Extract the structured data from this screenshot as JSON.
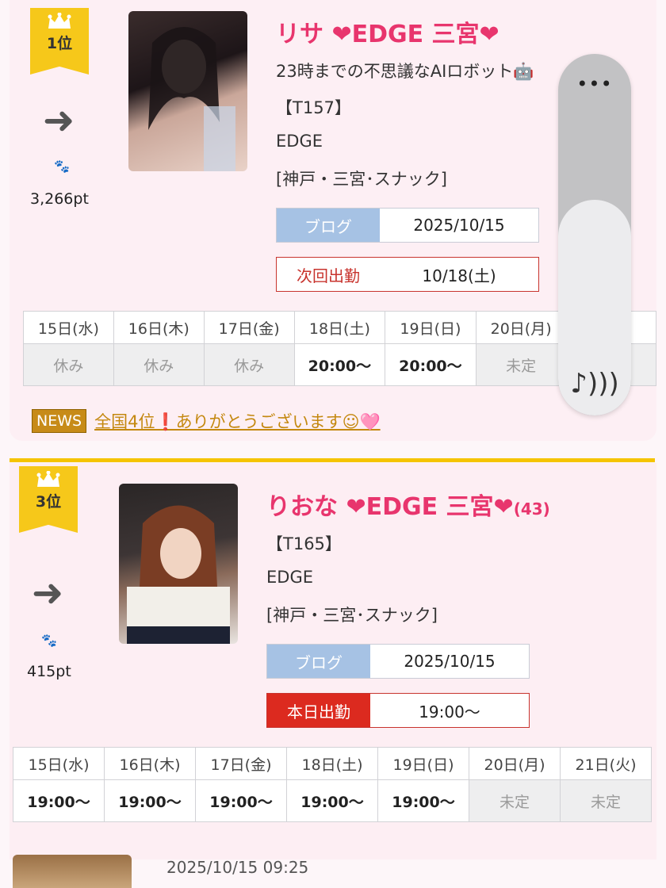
{
  "entries": [
    {
      "rank": "1位",
      "points": "3,266pt",
      "name": "リサ ❤EDGE 三宮❤",
      "age": "",
      "catch": "23時までの不思議なAIロボット🤖",
      "height": "【T157】",
      "shop": "EDGE",
      "area": "[神戸・三宮･スナック]",
      "blog_label": "ブログ",
      "blog_date": "2025/10/15",
      "shift_label": "次回出勤",
      "shift_value": "10/18(土)",
      "schedule": {
        "days": [
          "15日(水)",
          "16日(木)",
          "17日(金)",
          "18日(土)",
          "19日(日)",
          "20日(月)",
          ""
        ],
        "times": [
          "休み",
          "休み",
          "休み",
          "20:00〜",
          "20:00〜",
          "未定",
          ""
        ]
      },
      "news_tag": "NEWS",
      "news_text": "全国4位❗ありがとうございます☺🩷"
    },
    {
      "rank": "3位",
      "points": "415pt",
      "name": "りおな ❤EDGE 三宮❤",
      "age": "(43)",
      "height": "【T165】",
      "shop": "EDGE",
      "area": "[神戸・三宮･スナック]",
      "blog_label": "ブログ",
      "blog_date": "2025/10/15",
      "shift_label": "本日出勤",
      "shift_value": "19:00〜",
      "schedule": {
        "days": [
          "15日(水)",
          "16日(木)",
          "17日(金)",
          "18日(土)",
          "19日(日)",
          "20日(月)",
          "21日(火)"
        ],
        "times": [
          "19:00〜",
          "19:00〜",
          "19:00〜",
          "19:00〜",
          "19:00〜",
          "未定",
          "未定"
        ]
      }
    }
  ],
  "next_timestamp": "2025/10/15 09:25",
  "volume_panel": {
    "menu": "•••",
    "icon": "speaker-note-icon",
    "level": 0.6
  },
  "colors": {
    "accent": "#e8356d",
    "gold": "#f5c400",
    "today": "#dc2a1f",
    "blog": "#a6c2e4"
  }
}
